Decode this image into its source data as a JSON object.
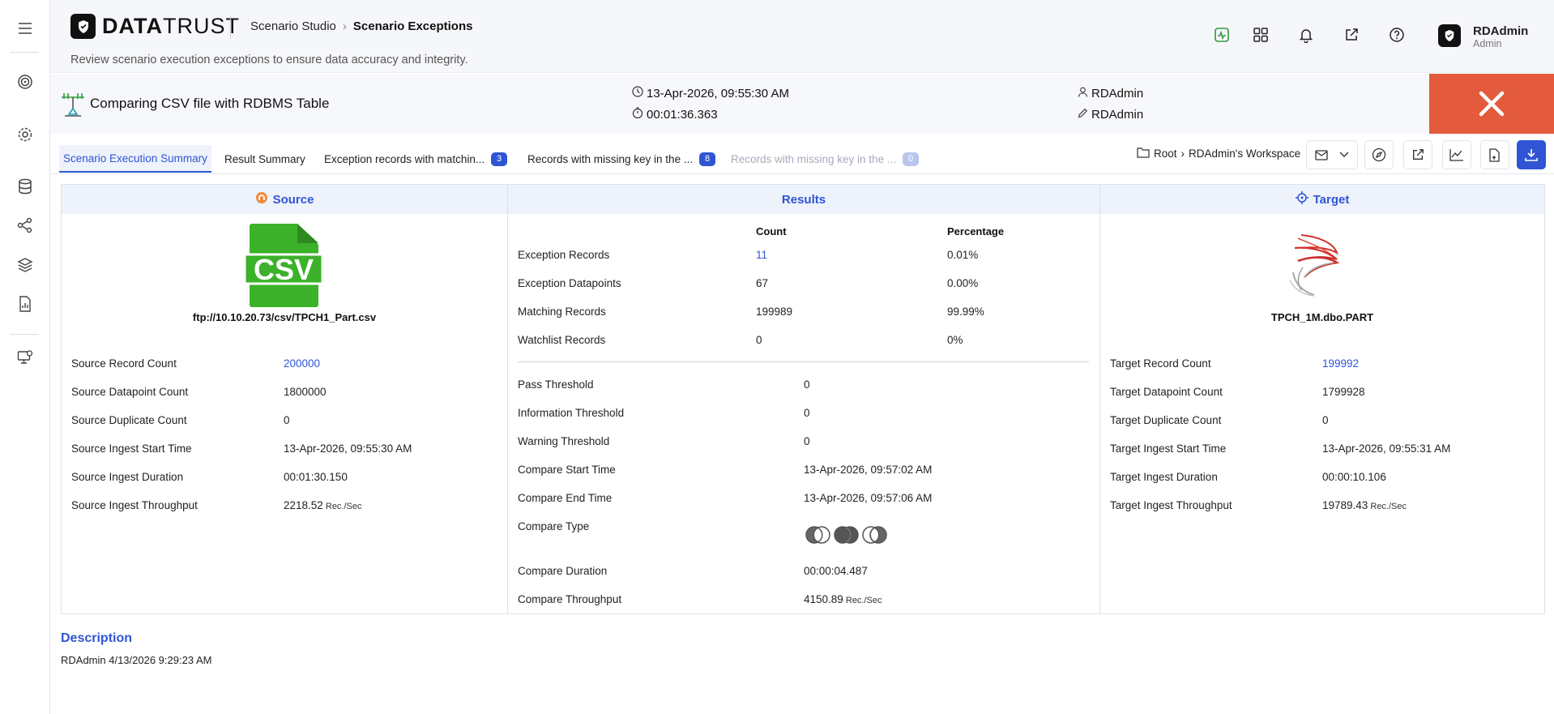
{
  "header": {
    "logo_bold": "DATA",
    "logo_light": "TRUST",
    "breadcrumb_parent": "Scenario Studio",
    "breadcrumb_current": "Scenario Exceptions",
    "subtitle": "Review scenario execution exceptions to ensure data accuracy and integrity.",
    "user_name": "RDAdmin",
    "user_role": "Admin"
  },
  "scenario": {
    "title": "Comparing CSV file with RDBMS Table",
    "start_time": "13-Apr-2026, 09:55:30 AM",
    "duration": "00:01:36.363",
    "created_by": "RDAdmin",
    "modified_by": "RDAdmin"
  },
  "tabs": [
    {
      "label": "Scenario Execution Summary",
      "active": true
    },
    {
      "label": "Result Summary"
    },
    {
      "label": "Exception records with matchin...",
      "badge": "3"
    },
    {
      "label": "Records with missing key in the ...",
      "badge": "8"
    },
    {
      "label": "Records with missing key in the ...",
      "badge": "0",
      "disabled": true
    }
  ],
  "workspace_path": {
    "root": "Root",
    "workspace": "RDAdmin's Workspace"
  },
  "source": {
    "heading": "Source",
    "file_badge": "CSV",
    "file_name": "ftp://10.10.20.73/csv/TPCH1_Part.csv",
    "rows": [
      {
        "label": "Source Record Count",
        "value": "200000",
        "link": true
      },
      {
        "label": "Source Datapoint Count",
        "value": "1800000"
      },
      {
        "label": "Source Duplicate Count",
        "value": "0"
      },
      {
        "label": "Source Ingest Start Time",
        "value": "13-Apr-2026, 09:55:30 AM"
      },
      {
        "label": "Source Ingest Duration",
        "value": "00:01:30.150"
      },
      {
        "label": "Source Ingest Throughput",
        "value": "2218.52",
        "unit": "Rec./Sec"
      }
    ]
  },
  "results": {
    "heading": "Results",
    "col_count": "Count",
    "col_percentage": "Percentage",
    "rows": [
      {
        "label": "Exception Records",
        "count": "11",
        "pct": "0.01%",
        "link": true
      },
      {
        "label": "Exception Datapoints",
        "count": "67",
        "pct": "0.00%"
      },
      {
        "label": "Matching Records",
        "count": "199989",
        "pct": "99.99%"
      },
      {
        "label": "Watchlist Records",
        "count": "0",
        "pct": "0%"
      }
    ],
    "details": [
      {
        "label": "Pass Threshold",
        "value": "0"
      },
      {
        "label": "Information Threshold",
        "value": "0"
      },
      {
        "label": "Warning Threshold",
        "value": "0"
      },
      {
        "label": "Compare Start Time",
        "value": "13-Apr-2026, 09:57:02 AM"
      },
      {
        "label": "Compare End Time",
        "value": "13-Apr-2026, 09:57:06 AM"
      },
      {
        "label": "Compare Type",
        "value": ""
      },
      {
        "label": "Compare Duration",
        "value": "00:00:04.487"
      },
      {
        "label": "Compare Throughput",
        "value": "4150.89",
        "unit": "Rec./Sec"
      }
    ]
  },
  "target": {
    "heading": "Target",
    "table_name": "TPCH_1M.dbo.PART",
    "rows": [
      {
        "label": "Target Record Count",
        "value": "199992",
        "link": true
      },
      {
        "label": "Target Datapoint Count",
        "value": "1799928"
      },
      {
        "label": "Target Duplicate Count",
        "value": "0"
      },
      {
        "label": "Target Ingest Start Time",
        "value": "13-Apr-2026, 09:55:31 AM"
      },
      {
        "label": "Target Ingest Duration",
        "value": "00:00:10.106"
      },
      {
        "label": "Target Ingest Throughput",
        "value": "19789.43",
        "unit": "Rec./Sec"
      }
    ]
  },
  "description": {
    "title": "Description",
    "text": "RDAdmin 4/13/2026 9:29:23 AM"
  },
  "colors": {
    "accent": "#2f55d4",
    "close": "#e35a3c",
    "csv_green": "#3cb12a"
  }
}
